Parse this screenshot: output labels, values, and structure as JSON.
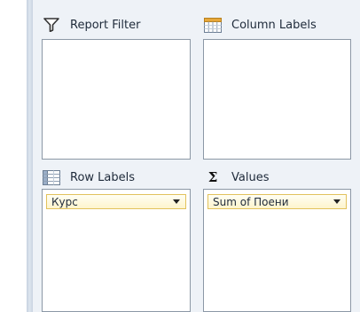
{
  "areas": {
    "report_filter": {
      "label": "Report Filter",
      "icon": "filter-funnel-icon"
    },
    "column_labels": {
      "label": "Column Labels",
      "icon": "column-grid-icon"
    },
    "row_labels": {
      "label": "Row Labels",
      "icon": "row-grid-icon",
      "fields": [
        {
          "label": "Курс"
        }
      ]
    },
    "values": {
      "label": "Values",
      "icon": "sigma-icon",
      "icon_glyph": "Σ",
      "fields": [
        {
          "label": "Sum of Поени"
        }
      ]
    }
  },
  "colors": {
    "pane_background": "#eef2f7",
    "dropbox_border": "#8c98a6",
    "field_pill_fill": "#fdf4cc",
    "field_pill_border": "#e2c25c"
  }
}
